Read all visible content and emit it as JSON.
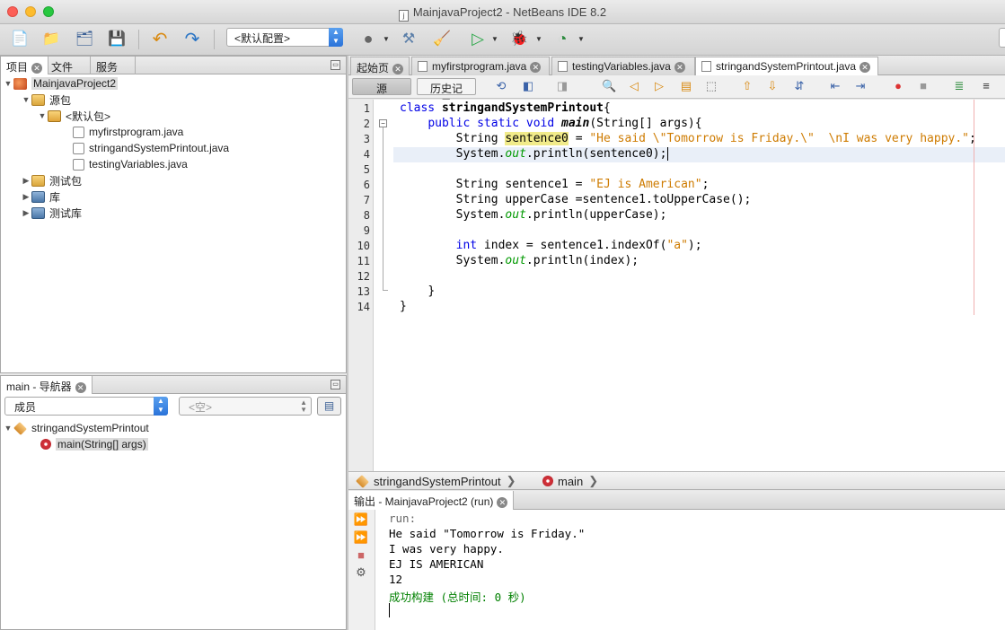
{
  "window": {
    "title": "MainjavaProject2 - NetBeans IDE 8.2"
  },
  "toolbar": {
    "config_value": "<默认配置>"
  },
  "projects_panel": {
    "tabs": [
      {
        "label": "项目"
      },
      {
        "label": "文件"
      },
      {
        "label": "服务"
      }
    ],
    "tree": [
      {
        "label": "MainjavaProject2"
      },
      {
        "label": "源包"
      },
      {
        "label": "<默认包>"
      },
      {
        "label": "myfirstprogram.java"
      },
      {
        "label": "stringandSystemPrintout.java"
      },
      {
        "label": "testingVariables.java"
      },
      {
        "label": "测试包"
      },
      {
        "label": "库"
      },
      {
        "label": "测试库"
      }
    ]
  },
  "navigator": {
    "tab_label": "main - 导航器",
    "members_value": "成员",
    "filter_value": "<空>",
    "tree": [
      {
        "label": "stringandSystemPrintout"
      },
      {
        "label": "main(String[] args)"
      }
    ]
  },
  "editor": {
    "tabs": [
      {
        "label": "起始页"
      },
      {
        "label": "myfirstprogram.java"
      },
      {
        "label": "testingVariables.java"
      },
      {
        "label": "stringandSystemPrintout.java"
      }
    ],
    "source_button": "源",
    "history_button": "历史记录",
    "line_numbers": [
      "1",
      "2",
      "3",
      "4",
      "5",
      "6",
      "7",
      "8",
      "9",
      "10",
      "11",
      "12",
      "13",
      "14"
    ],
    "code": {
      "l1_kw": "class ",
      "l1_name": "stringandSystemPrintout",
      "l1_rest": "{",
      "l2_kw": "public static void ",
      "l2_name": "main",
      "l2_rest": "(String[] args){",
      "l3_a": "String ",
      "l3_var": "sentence0",
      "l3_b": " = ",
      "l3_str": "\"He said \\\"Tomorrow is Friday.\\\"  \\nI was very happy.\"",
      "l3_c": ";",
      "l4_a": "System.",
      "l4_fld": "out",
      "l4_b": ".println(sentence0);",
      "l6_a": "String sentence1 = ",
      "l6_str": "\"EJ is American\"",
      "l6_c": ";",
      "l7": "String upperCase =sentence1.toUpperCase();",
      "l8_a": "System.",
      "l8_fld": "out",
      "l8_b": ".println(upperCase);",
      "l10_kw": "int",
      "l10_a": " index = sentence1.indexOf(",
      "l10_str": "\"a\"",
      "l10_c": ");",
      "l11_a": "System.",
      "l11_fld": "out",
      "l11_b": ".println(index);",
      "l13": "}",
      "l14": "}"
    }
  },
  "breadcrumb": {
    "class_label": "stringandSystemPrintout",
    "method_label": "main"
  },
  "output": {
    "tab_label": "输出 - MainjavaProject2 (run)",
    "lines": [
      "run:",
      "He said \"Tomorrow is Friday.\"",
      "I was very happy.",
      "EJ IS AMERICAN",
      "12",
      "成功构建 (总时间: 0 秒)"
    ]
  },
  "colors": {
    "keyword": "#0000e6",
    "string": "#ce7b00",
    "field": "#009900",
    "build_success": "#008000"
  }
}
